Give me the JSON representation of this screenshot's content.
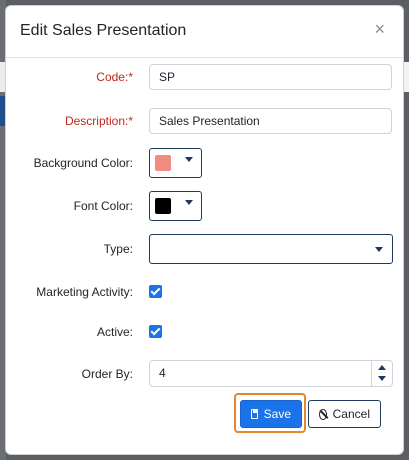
{
  "dialog": {
    "title": "Edit Sales Presentation",
    "close_symbol": "×"
  },
  "form": {
    "code": {
      "label": "Code:*",
      "value": "SP"
    },
    "description": {
      "label": "Description:*",
      "value": "Sales Presentation"
    },
    "background_color": {
      "label": "Background Color:",
      "value": "#f28b82"
    },
    "font_color": {
      "label": "Font Color:",
      "value": "#000000"
    },
    "type": {
      "label": "Type:",
      "value": ""
    },
    "marketing_activity": {
      "label": "Marketing Activity:",
      "checked": true
    },
    "active": {
      "label": "Active:",
      "checked": true
    },
    "order_by": {
      "label": "Order By:",
      "value": "4"
    }
  },
  "buttons": {
    "save": {
      "label": "Save",
      "icon": "save-icon"
    },
    "cancel": {
      "label": "Cancel",
      "icon": "ban-icon"
    }
  },
  "colors": {
    "primary": "#1a73e8",
    "required_label": "#c0281e",
    "focus_highlight": "#e08a2e"
  }
}
